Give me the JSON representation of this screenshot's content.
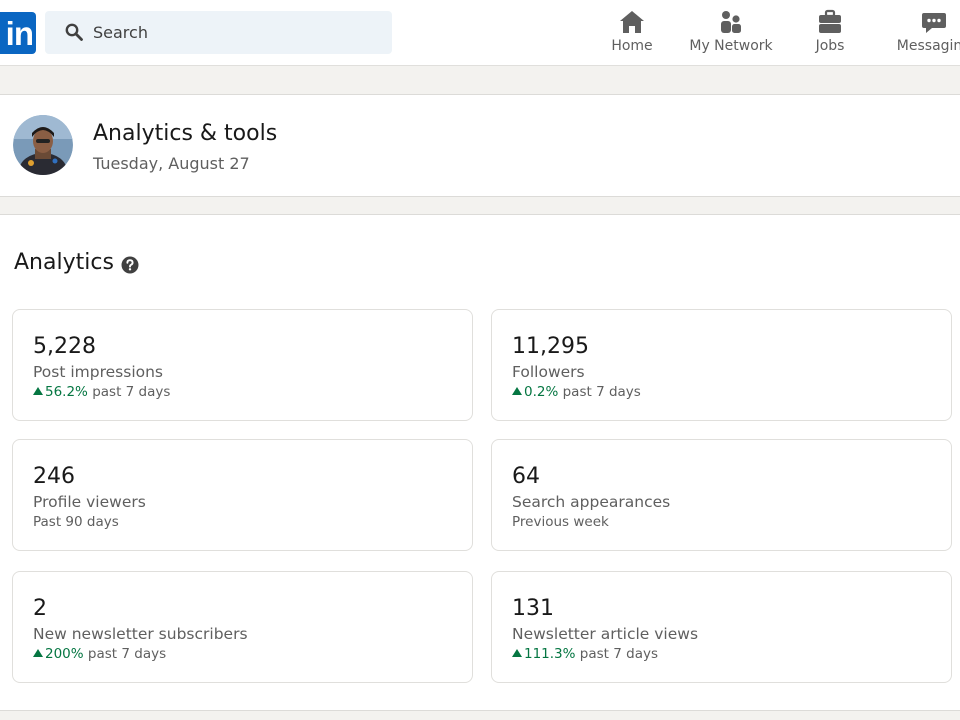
{
  "nav": {
    "logo_text": "in",
    "search_placeholder": "Search",
    "items": [
      {
        "label": "Home",
        "icon": "home-icon"
      },
      {
        "label": "My Network",
        "icon": "people-icon"
      },
      {
        "label": "Jobs",
        "icon": "briefcase-icon"
      },
      {
        "label": "Messaging",
        "icon": "chat-icon"
      }
    ]
  },
  "header": {
    "title": "Analytics & tools",
    "date": "Tuesday, August 27"
  },
  "analytics": {
    "title": "Analytics",
    "cards": [
      {
        "value": "5,228",
        "label": "Post impressions",
        "trend": "56.2%",
        "period": "past 7 days"
      },
      {
        "value": "11,295",
        "label": "Followers",
        "trend": "0.2%",
        "period": "past 7 days"
      },
      {
        "value": "246",
        "label": "Profile viewers",
        "period": "Past 90 days"
      },
      {
        "value": "64",
        "label": "Search appearances",
        "period": "Previous week"
      },
      {
        "value": "2",
        "label": "New newsletter subscribers",
        "trend": "200%",
        "period": "past 7 days"
      },
      {
        "value": "131",
        "label": "Newsletter article views",
        "trend": "111.3%",
        "period": "past 7 days"
      }
    ]
  },
  "colors": {
    "brand": "#0a66c2",
    "trend_up": "#057642",
    "background": "#f3f2ef"
  }
}
